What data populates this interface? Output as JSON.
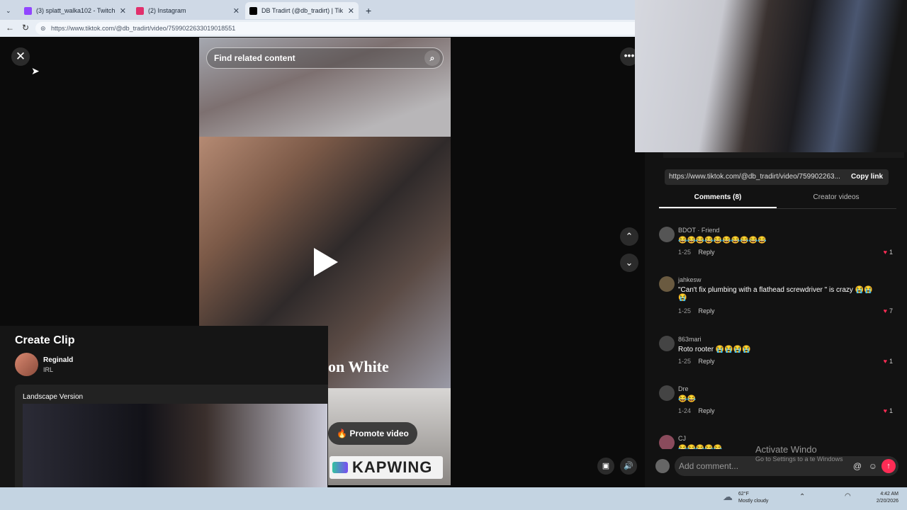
{
  "browser": {
    "tabs": [
      {
        "title": "(3) splatt_walka102 - Twitch",
        "color": "#9146ff"
      },
      {
        "title": "(2) Instagram",
        "color": "#e1306c"
      },
      {
        "title": "DB Tradirt (@db_tradirt) | Tik",
        "color": "#000000"
      }
    ],
    "url": "https://www.tiktok.com/@db_tradirt/video/7599022633019018551"
  },
  "viewer": {
    "search_placeholder": "Find related content",
    "overlay_text": "on White",
    "promote_label": "Promote video",
    "kapwing_label": "KAPWING"
  },
  "right_panel": {
    "link": "https://www.tiktok.com/@db_tradirt/video/759902263...",
    "copy_label": "Copy link",
    "tab_comments": "Comments (8)",
    "tab_creator": "Creator videos",
    "comments": [
      {
        "name": "BDOT · Friend",
        "text": "😂😂😂😂😂😂😂😂😂😂",
        "date": "1-25",
        "reply": "Reply",
        "likes": "1"
      },
      {
        "name": "jahkesw",
        "text": "\"Can't fix plumbing with a flathead screwdriver \" is crazy 😭😭😭",
        "date": "1-25",
        "reply": "Reply",
        "likes": "7"
      },
      {
        "name": "863mari",
        "text": "Roto rooter 😭😭😭😭",
        "date": "1-25",
        "reply": "Reply",
        "likes": "1"
      },
      {
        "name": "Dre",
        "text": "😂😂",
        "date": "1-24",
        "reply": "Reply",
        "likes": "1"
      },
      {
        "name": "CJ",
        "text": "😂😂😂😂😂",
        "date": "",
        "reply": "",
        "likes": ""
      }
    ],
    "add_comment_placeholder": "Add comment...",
    "watermark_title": "Activate Windo",
    "watermark_sub": "Go to Settings to a       te Windows"
  },
  "clip": {
    "title": "Create Clip",
    "streamer": "Reginald",
    "category": "IRL",
    "version_label": "Landscape Version"
  },
  "taskbar": {
    "temp": "62°F",
    "weather": "Mostly cloudy",
    "time": "4:42 AM",
    "date": "2/20/2026"
  },
  "colors": {
    "accent": "#fe2c55",
    "background": "#121212"
  }
}
